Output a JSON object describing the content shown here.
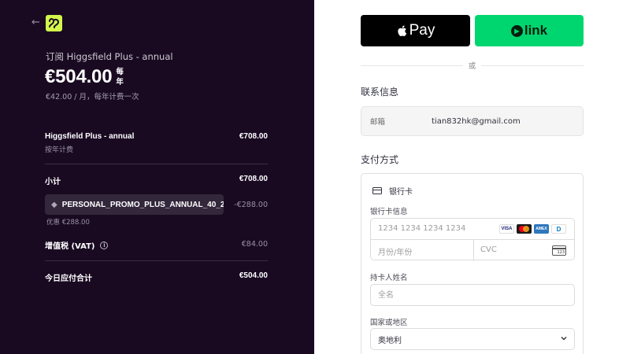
{
  "summary": {
    "back_label": "←",
    "product_title": "订阅 Higgsfield Plus - annual",
    "price": "€504.00",
    "period_line1": "每",
    "period_line2": "年",
    "per_month": "€42.00 / 月，每年计费一次",
    "item_name": "Higgsfield Plus - annual",
    "item_billing": "按年计费",
    "item_amount": "€708.00",
    "subtotal_label": "小计",
    "subtotal_amount": "€708.00",
    "promo_code": "PERSONAL_PROMO_PLUS_ANNUAL_40_2",
    "promo_amount": "-€288.00",
    "discount_note": "优惠 €288.00",
    "vat_label": "增值税 (VAT)",
    "vat_amount": "€84.00",
    "total_label": "今日应付合计",
    "total_amount": "€504.00"
  },
  "payment": {
    "apple_pay_label": "Pay",
    "link_label": "link",
    "or_label": "或",
    "contact_title": "联系信息",
    "email_label": "邮箱",
    "email_value": "tian832hk@gmail.com",
    "method_title": "支付方式",
    "card_tab_label": "银行卡",
    "card_info_label": "银行卡信息",
    "card_number_placeholder": "1234 1234 1234 1234",
    "expiry_placeholder": "月份/年份",
    "cvc_placeholder": "CVC",
    "cvc_icon_text": "123",
    "cardholder_label": "持卡人姓名",
    "cardholder_placeholder": "全名",
    "country_label": "国家或地区",
    "country_value": "奥地利",
    "brands": [
      "VISA",
      "",
      "AMEX",
      "D"
    ]
  },
  "colors": {
    "left_bg": "#190a22",
    "brand_lime": "#d2f74a",
    "link_green": "#00d66f"
  }
}
